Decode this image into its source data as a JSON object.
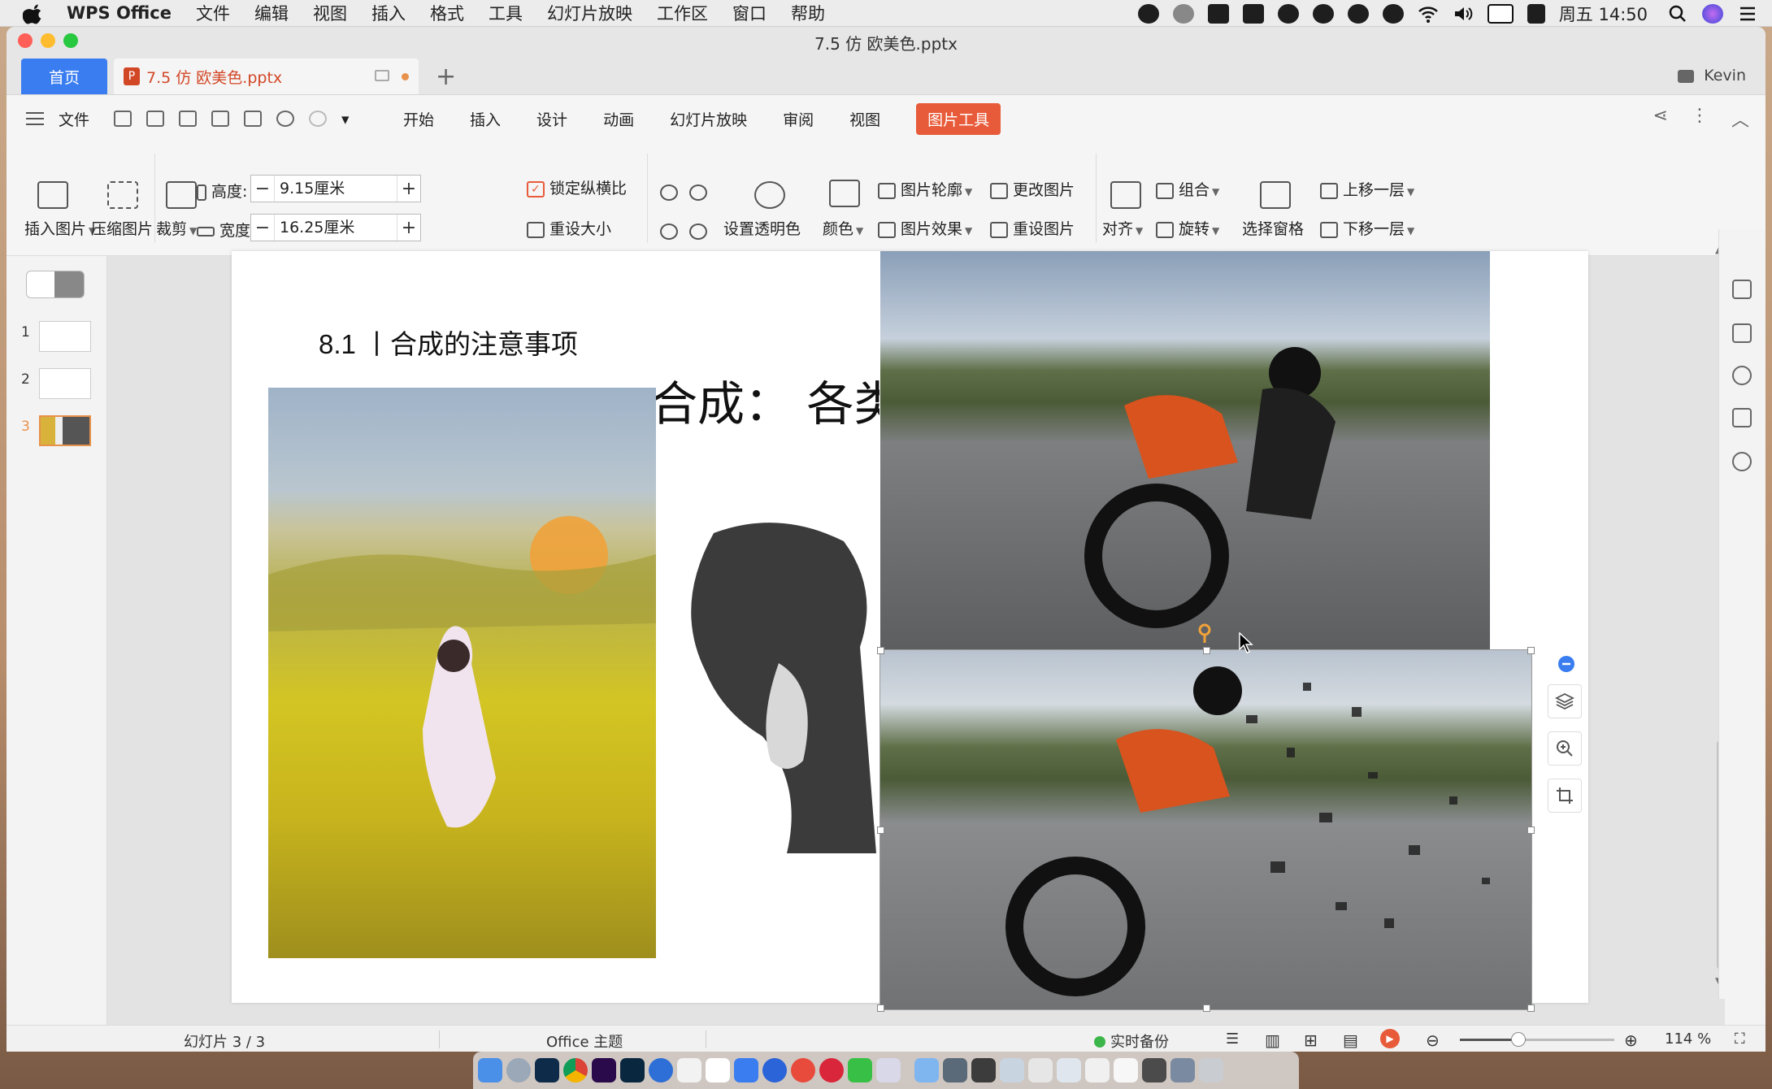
{
  "menubar": {
    "app_name": "WPS Office",
    "items": [
      "文件",
      "编辑",
      "视图",
      "插入",
      "格式",
      "工具",
      "幻灯片放映",
      "工作区",
      "窗口",
      "帮助"
    ],
    "clock": "周五 14:50"
  },
  "window": {
    "title": "7.5 仿 欧美色.pptx",
    "home_tab": "首页",
    "file_tab": "7.5 仿 欧美色.pptx",
    "add_tab": "+",
    "user": "Kevin"
  },
  "menu": {
    "file": "文件",
    "tabs": [
      "开始",
      "插入",
      "设计",
      "动画",
      "幻灯片放映",
      "审阅",
      "视图",
      "图片工具"
    ],
    "active_tab": "图片工具"
  },
  "ribbon": {
    "insert_picture": "插入图片",
    "compress_picture": "压缩图片",
    "crop": "裁剪",
    "height_label": "高度:",
    "height_value": "9.15厘米",
    "width_label": "宽度:",
    "width_value": "16.25厘米",
    "lock_aspect": "锁定纵横比",
    "lock_aspect_checked": true,
    "reset_size": "重设大小",
    "set_transparent": "设置透明色",
    "color": "颜色",
    "picture_outline": "图片轮廓",
    "picture_effects": "图片效果",
    "change_picture": "更改图片",
    "reset_picture": "重设图片",
    "align": "对齐",
    "group": "组合",
    "rotate": "旋转",
    "selection_pane": "选择窗格",
    "bring_forward": "上移一层",
    "send_backward": "下移一层"
  },
  "slides": {
    "numbers": [
      "1",
      "2",
      "3"
    ],
    "selected": 3
  },
  "slide": {
    "heading": "8.1 丨合成的注意事项",
    "big_text": "合成：  各类素"
  },
  "status": {
    "slide_counter": "幻灯片 3 / 3",
    "theme": "Office 主题",
    "backup": "实时备份",
    "zoom": "114 %",
    "zoom_fraction": 0.38
  },
  "colors": {
    "accent": "#3a7df0",
    "active_tab": "#e85b3a",
    "selected_thumb": "#e8914a",
    "backup_dot": "#3cb64a"
  }
}
